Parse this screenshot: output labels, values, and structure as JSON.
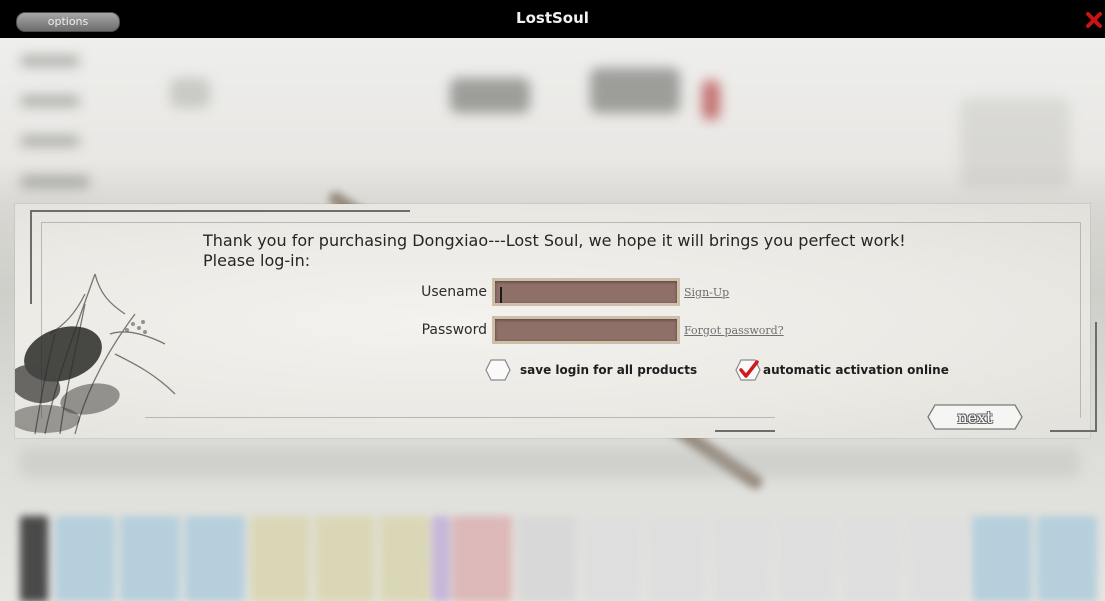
{
  "window": {
    "title": "LostSoul",
    "options_label": "options",
    "close_icon": "close-icon"
  },
  "dialog": {
    "message_line1": "Thank you for purchasing Dongxiao---Lost Soul, we hope it will brings you perfect work!",
    "message_line2": "Please log-in:",
    "username_label": "Usename",
    "username_value": "",
    "password_label": "Password",
    "password_value": "",
    "signup_link": "Sign-Up",
    "forgot_link": "Forgot password?",
    "save_login_label": "save login for all products",
    "save_login_checked": false,
    "auto_activation_label": "automatic activation online",
    "auto_activation_checked": true,
    "next_label": "next"
  },
  "colors": {
    "titlebar": "#000000",
    "input_fill": "#8f7068",
    "input_border": "#cdbfa9",
    "check_mark": "#d11a1a",
    "close_x": "#c81414"
  }
}
